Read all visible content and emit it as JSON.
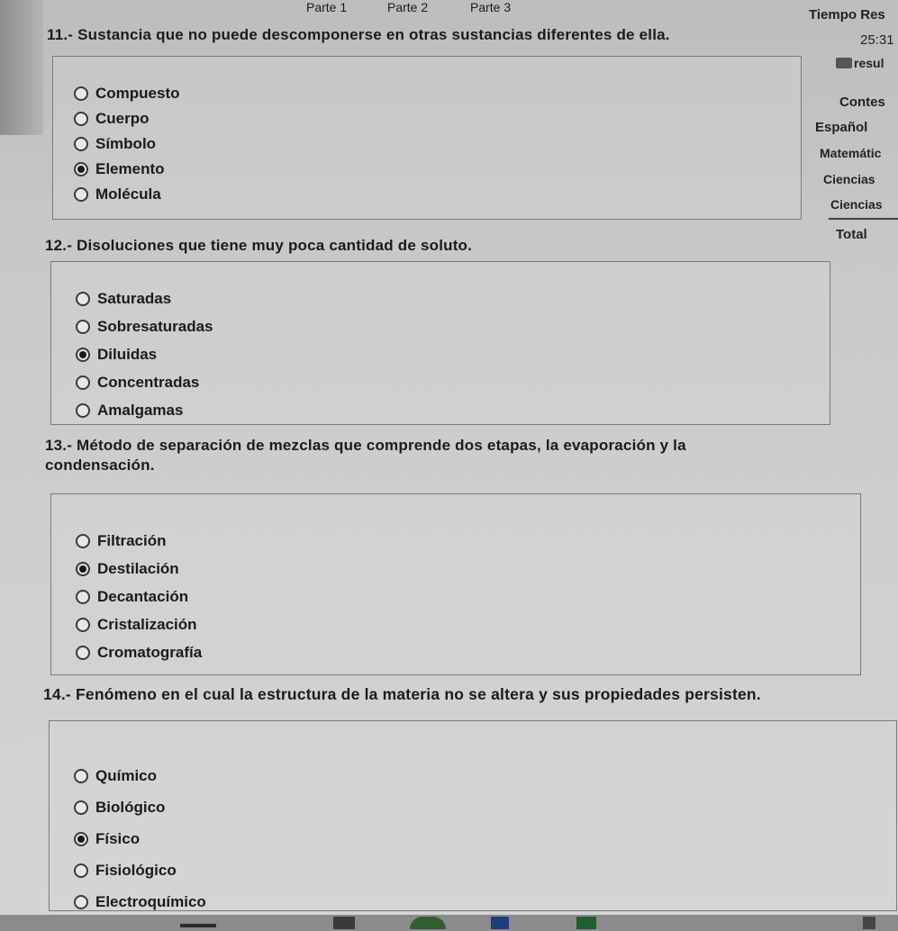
{
  "tabs": [
    "Parte 1",
    "Parte 2",
    "Parte 3"
  ],
  "side": {
    "timer_label": "Tiempo Res",
    "timer_value": "25:31",
    "results": "resul",
    "answered": "Contes",
    "subjects": [
      "Español",
      "Matemátic",
      "Ciencias",
      "Ciencias"
    ],
    "total": "Total"
  },
  "questions": [
    {
      "title": "11.- Sustancia que no puede descomponerse en otras sustancias diferentes de ella.",
      "options": [
        "Compuesto",
        "Cuerpo",
        "Símbolo",
        "Elemento",
        "Molécula"
      ],
      "selected": 3
    },
    {
      "title": "12.- Disoluciones que tiene muy poca cantidad de soluto.",
      "options": [
        "Saturadas",
        "Sobresaturadas",
        "Diluidas",
        "Concentradas",
        "Amalgamas"
      ],
      "selected": 2
    },
    {
      "title_line1": "13.- Método de separación de mezclas que comprende dos etapas, la evaporación y la",
      "title_line2": "condensación.",
      "options": [
        "Filtración",
        "Destilación",
        "Decantación",
        "Cristalización",
        "Cromatografía"
      ],
      "selected": 1
    },
    {
      "title": "14.- Fenómeno en el cual la estructura de la materia no se altera y sus propiedades persisten.",
      "options": [
        "Químico",
        "Biológico",
        "Físico",
        "Fisiológico",
        "Electroquímico"
      ],
      "selected": 2
    }
  ]
}
